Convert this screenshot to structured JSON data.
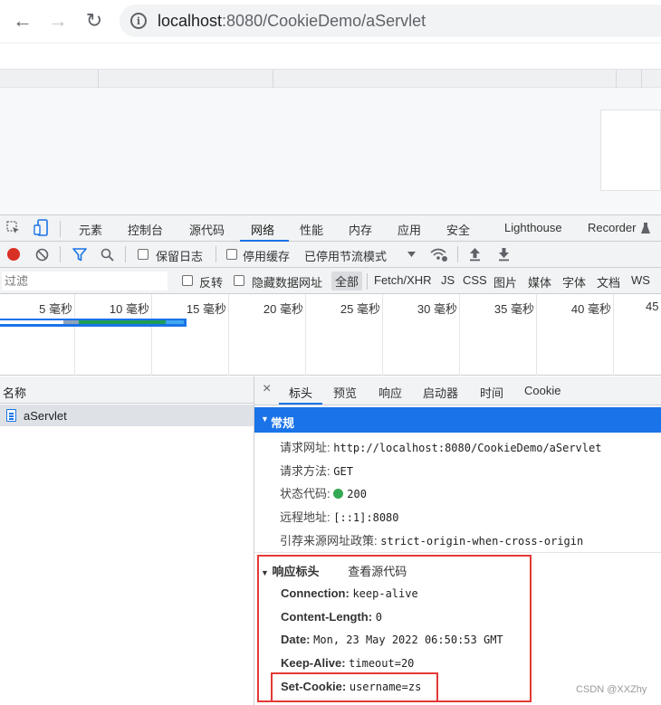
{
  "browser": {
    "back_icon": "←",
    "forward_icon": "→",
    "reload_icon": "↻",
    "url_host": "localhost",
    "url_rest": ":8080/CookieDemo/aServlet"
  },
  "devtools": {
    "tabs": [
      "元素",
      "控制台",
      "源代码",
      "网络",
      "性能",
      "内存",
      "应用",
      "安全",
      "Lighthouse",
      "Recorder"
    ],
    "active_tab": "网络",
    "toolbar": {
      "preserve_log": "保留日志",
      "disable_cache": "停用缓存",
      "throttle": "已停用节流模式"
    },
    "filter": {
      "placeholder": "过滤",
      "invert": "反转",
      "hide_data_urls": "隐藏数据网址",
      "types": [
        "全部",
        "Fetch/XHR",
        "JS",
        "CSS",
        "图片",
        "媒体",
        "字体",
        "文档",
        "WS"
      ]
    },
    "timeline_ticks": [
      "5 毫秒",
      "10 毫秒",
      "15 毫秒",
      "20 毫秒",
      "25 毫秒",
      "30 毫秒",
      "35 毫秒",
      "40 毫秒",
      "45"
    ],
    "requests": {
      "header": "名称",
      "rows": [
        {
          "name": "aServlet"
        }
      ]
    },
    "details": {
      "close_icon": "×",
      "tabs": [
        "标头",
        "预览",
        "响应",
        "启动器",
        "时间",
        "Cookie"
      ],
      "general": {
        "title": "常规",
        "items": [
          {
            "key": "请求网址:",
            "value": "http://localhost:8080/CookieDemo/aServlet"
          },
          {
            "key": "请求方法:",
            "value": "GET"
          },
          {
            "key": "状态代码:",
            "value": "200"
          },
          {
            "key": "远程地址:",
            "value": "[::1]:8080"
          },
          {
            "key": "引荐来源网址政策:",
            "value": "strict-origin-when-cross-origin"
          }
        ]
      },
      "response_headers": {
        "title": "响应标头",
        "view_source": "查看源代码",
        "items": [
          {
            "key": "Connection:",
            "value": "keep-alive"
          },
          {
            "key": "Content-Length:",
            "value": "0"
          },
          {
            "key": "Date:",
            "value": "Mon, 23 May 2022 06:50:53 GMT"
          },
          {
            "key": "Keep-Alive:",
            "value": "timeout=20"
          },
          {
            "key": "Set-Cookie:",
            "value": "username=zs"
          }
        ]
      }
    }
  },
  "watermark": "CSDN @XXZhy",
  "colors": {
    "accent": "#1a73e8",
    "highlight_box": "#e53935",
    "status_ok": "#34a853"
  }
}
